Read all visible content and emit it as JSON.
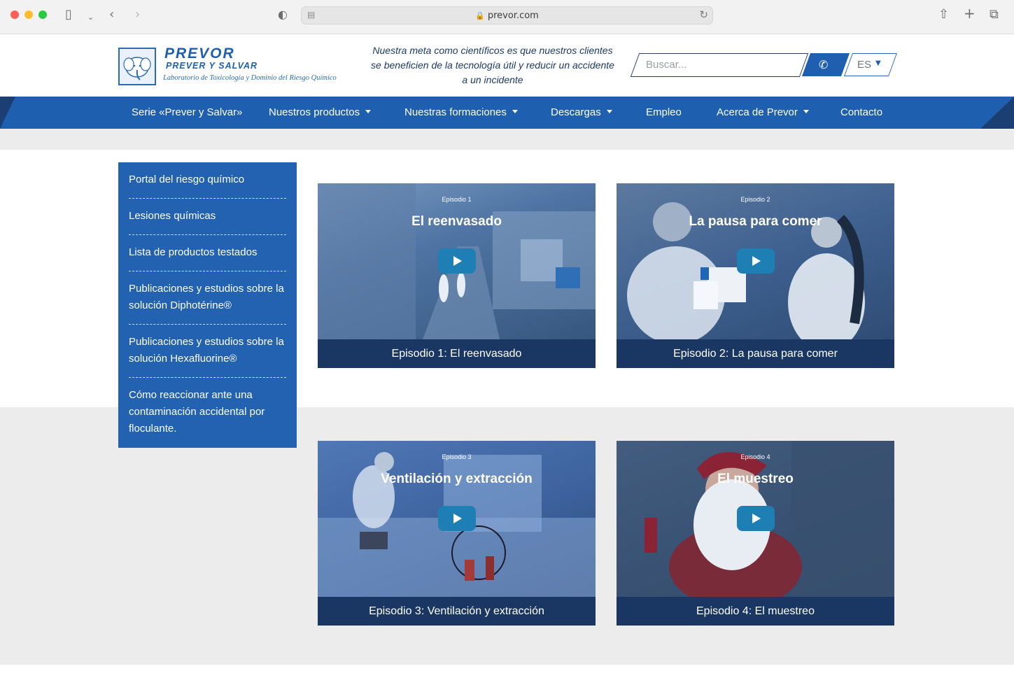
{
  "browser": {
    "url": "prevor.com"
  },
  "header": {
    "logo_title": "PREVOR",
    "logo_subtitle": "PREVER Y SALVAR",
    "logo_tagline": "Laboratorio de Toxicología y Dominio del Riesgo Químico",
    "mission": "Nuestra meta como científicos es que nuestros clientes se beneficien de la tecnología útil y reducir un accidente a un incidente",
    "search_placeholder": "Buscar...",
    "language": "ES"
  },
  "nav": {
    "items": [
      {
        "label": "Serie «Prever y Salvar»",
        "dropdown": false
      },
      {
        "label": "Nuestros productos",
        "dropdown": true
      },
      {
        "label": "Nuestras formaciones",
        "dropdown": true
      },
      {
        "label": "Descargas",
        "dropdown": true
      },
      {
        "label": "Empleo",
        "dropdown": false
      },
      {
        "label": "Acerca de Prevor",
        "dropdown": true
      },
      {
        "label": "Contacto",
        "dropdown": false
      }
    ]
  },
  "sidebar": {
    "items": [
      "Portal del riesgo químico",
      "Lesiones químicas",
      "Lista de productos testados",
      "Publicaciones y estudios sobre la solución Diphotérine®",
      "Publicaciones y estudios sobre la solución Hexafluorine®",
      "Cómo reaccionar ante una contaminación accidental por floculante."
    ]
  },
  "videos": [
    {
      "episode_label": "Episodio 1",
      "title": "El reenvasado",
      "caption": "Episodio 1: El reenvasado"
    },
    {
      "episode_label": "Episodio 2",
      "title": "La pausa para comer",
      "caption": "Episodio 2: La pausa para comer"
    },
    {
      "episode_label": "Episodio 3",
      "title": "Ventilación y extracción",
      "caption": "Episodio 3: Ventilación y extracción"
    },
    {
      "episode_label": "Episodio 4",
      "title": "El muestreo",
      "caption": "Episodio 4: El muestreo"
    }
  ],
  "colors": {
    "brand_blue": "#1f5fb0",
    "dark_navy": "#1a3763",
    "play_button": "#1e7fb5"
  }
}
